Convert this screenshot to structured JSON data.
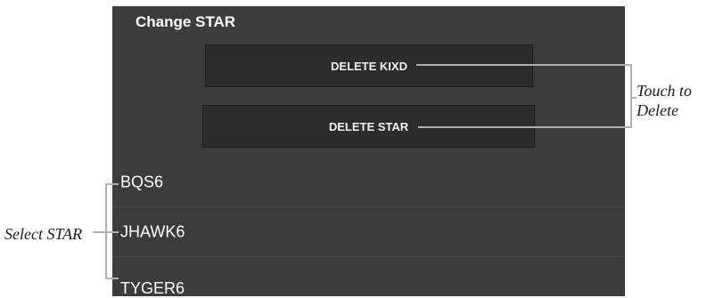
{
  "panel": {
    "title": "Change STAR",
    "buttons": [
      {
        "label": "DELETE KIXD"
      },
      {
        "label": "DELETE STAR"
      }
    ],
    "stars": [
      {
        "label": "BQS6"
      },
      {
        "label": "JHAWK6"
      },
      {
        "label": "TYGER6"
      }
    ]
  },
  "callouts": {
    "touch_line1": "Touch to",
    "touch_line2": "Delete",
    "select": "Select STAR"
  },
  "colors": {
    "panel_bg": "#3c3c3c",
    "button_bg": "#2c2c2c",
    "leader_line": "#b0b0b0"
  }
}
